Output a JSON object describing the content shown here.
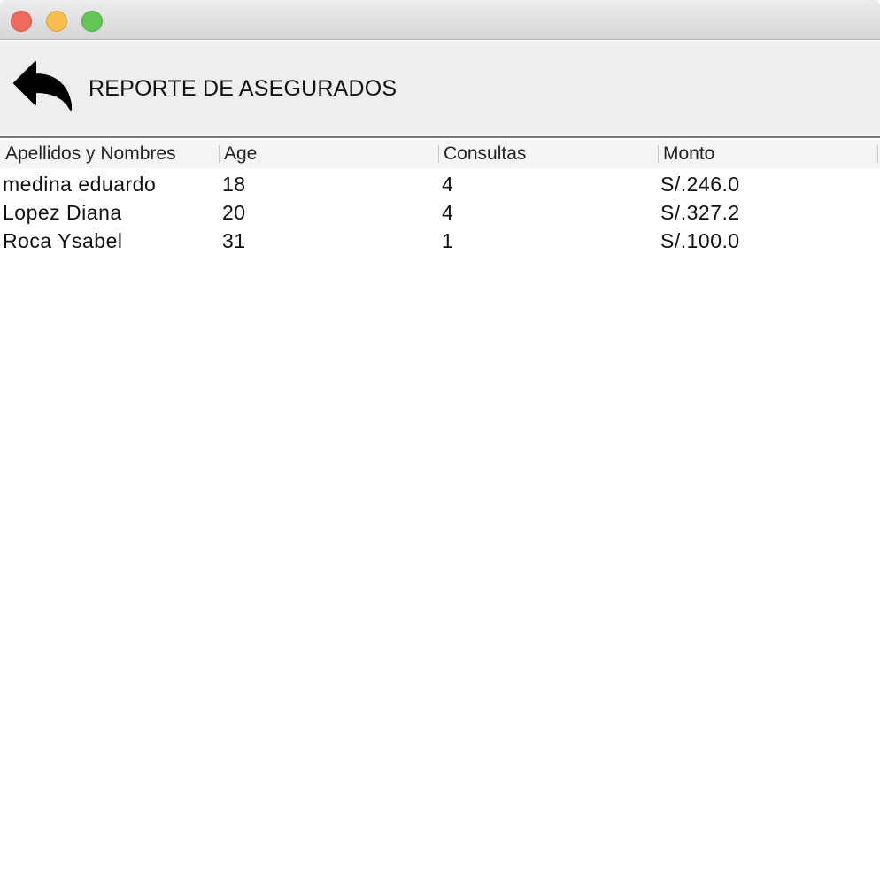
{
  "window": {
    "buttons": {
      "close": "close-button",
      "minimize": "minimize-button",
      "maximize": "maximize-button"
    },
    "colors": {
      "close": "#ee6a5f",
      "minimize": "#f5be4f",
      "maximize": "#62c655"
    }
  },
  "header": {
    "back_icon": "reply-arrow-icon",
    "title": "REPORTE DE ASEGURADOS"
  },
  "table": {
    "columns": [
      "Apellidos y Nombres",
      "Age",
      "Consultas",
      "Monto"
    ],
    "rows": [
      [
        "medina eduardo",
        "18",
        "4",
        "S/.246.0"
      ],
      [
        "Lopez Diana",
        "20",
        "4",
        "S/.327.2"
      ],
      [
        "Roca Ysabel",
        "31",
        "1",
        "S/.100.0"
      ]
    ]
  }
}
